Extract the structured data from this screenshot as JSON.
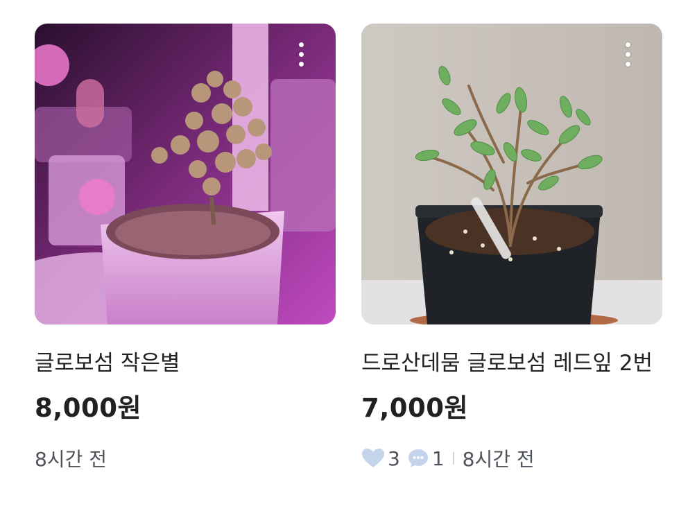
{
  "items": [
    {
      "title": "글로보섬 작은별",
      "price": "8,000원",
      "time": "8시간 전",
      "likes": null,
      "comments": null
    },
    {
      "title": "드로산데뭄 글로보섬 레드잎 2번",
      "price": "7,000원",
      "time": "8시간 전",
      "likes": "3",
      "comments": "1"
    }
  ],
  "icons": {
    "more": "more-vertical-icon",
    "heart": "heart-icon",
    "chat": "chat-bubble-icon"
  },
  "colors": {
    "text_primary": "#212124",
    "text_secondary": "#4d5159",
    "icon_fill": "#c4d4ea"
  }
}
